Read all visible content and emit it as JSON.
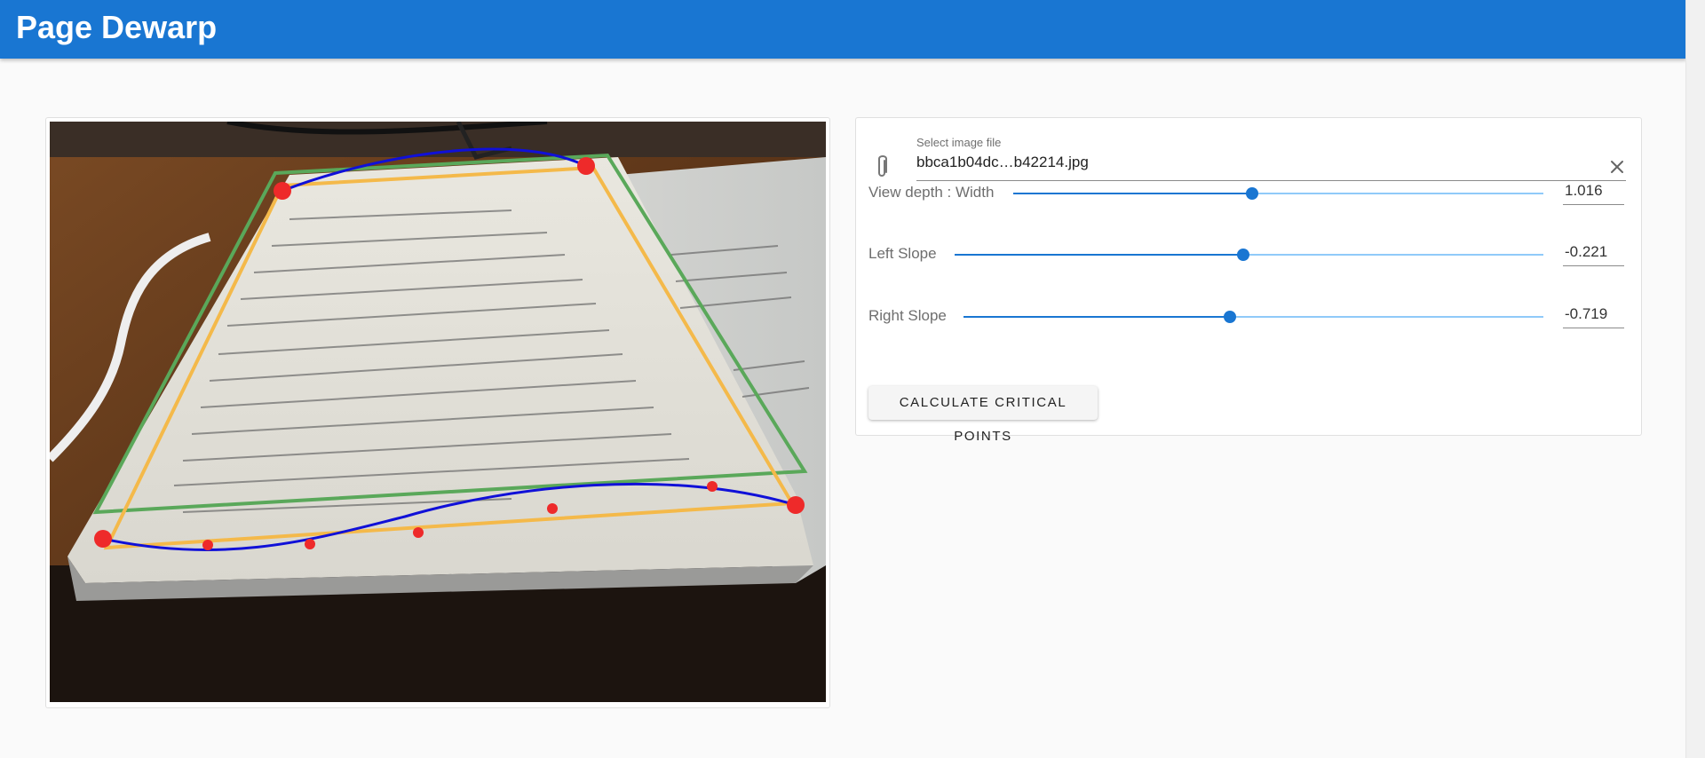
{
  "app": {
    "title": "Page Dewarp"
  },
  "file": {
    "label": "Select image file",
    "value": "bbca1b04dc…b42214.jpg"
  },
  "sliders": [
    {
      "label": "View depth : Width",
      "value": "1.016",
      "fraction": 0.45
    },
    {
      "label": "Left Slope",
      "value": "-0.221",
      "fraction": 0.49
    },
    {
      "label": "Right Slope",
      "value": "-0.719",
      "fraction": 0.46
    }
  ],
  "actions": {
    "calculate_label": "CALCULATE CRITICAL POINTS"
  },
  "icons": {
    "file": "paperclip-icon",
    "clear": "close-icon"
  },
  "colors": {
    "primary": "#1976d2",
    "track": "#90caf9",
    "outline_green": "#5aa85a",
    "outline_orange": "#f4b94a",
    "curve_blue": "#1010d8",
    "point_red": "#ee2a2a"
  }
}
